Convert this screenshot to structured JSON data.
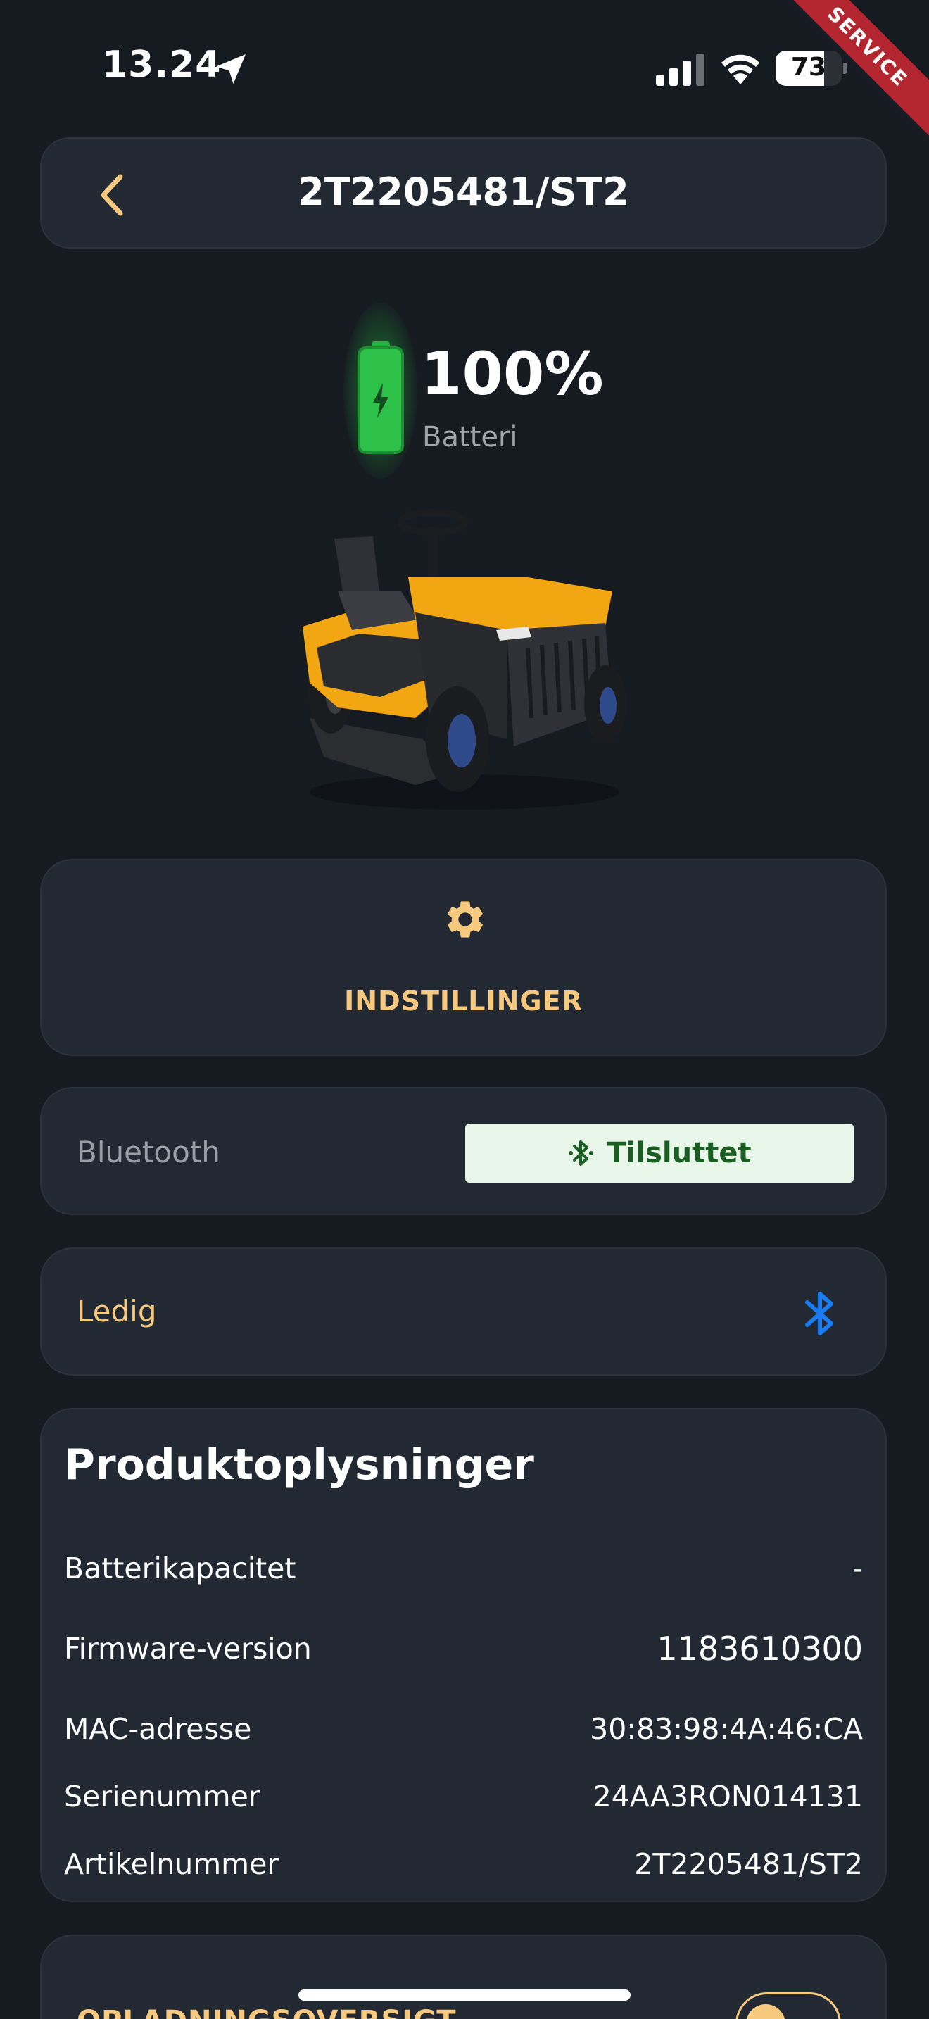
{
  "status_bar": {
    "time": "13.24",
    "battery_percent": "73",
    "battery_level": 0.73,
    "service_badge": "SERVICE"
  },
  "header": {
    "title": "2T2205481/ST2",
    "back_icon": "chevron-left-icon"
  },
  "battery": {
    "percent_text": "100%",
    "label": "Batteri",
    "level": 1.0,
    "color": "#2ec24a"
  },
  "settings": {
    "icon": "gear-icon",
    "label": "INDSTILLINGER"
  },
  "bluetooth": {
    "label": "Bluetooth",
    "status": "Tilsluttet",
    "icon": "bluetooth-icon"
  },
  "device_status": {
    "label": "Ledig",
    "icon": "bluetooth-icon",
    "icon_color": "#1a7cf0"
  },
  "product_info": {
    "title": "Produktoplysninger",
    "rows": [
      {
        "key": "Batterikapacitet",
        "value": "-"
      },
      {
        "key": "Firmware-version",
        "value": "1183610300"
      },
      {
        "key": "MAC-adresse",
        "value": "30:83:98:4A:46:CA"
      },
      {
        "key": "Serienummer",
        "value": "24AA3RON014131"
      },
      {
        "key": "Artikelnummer",
        "value": "2T2205481/ST2"
      }
    ]
  },
  "charging": {
    "label": "OPLADNINGSOVERSIGT"
  },
  "colors": {
    "background": "#161b22",
    "card": "#222933",
    "accent": "#f7c97e"
  }
}
